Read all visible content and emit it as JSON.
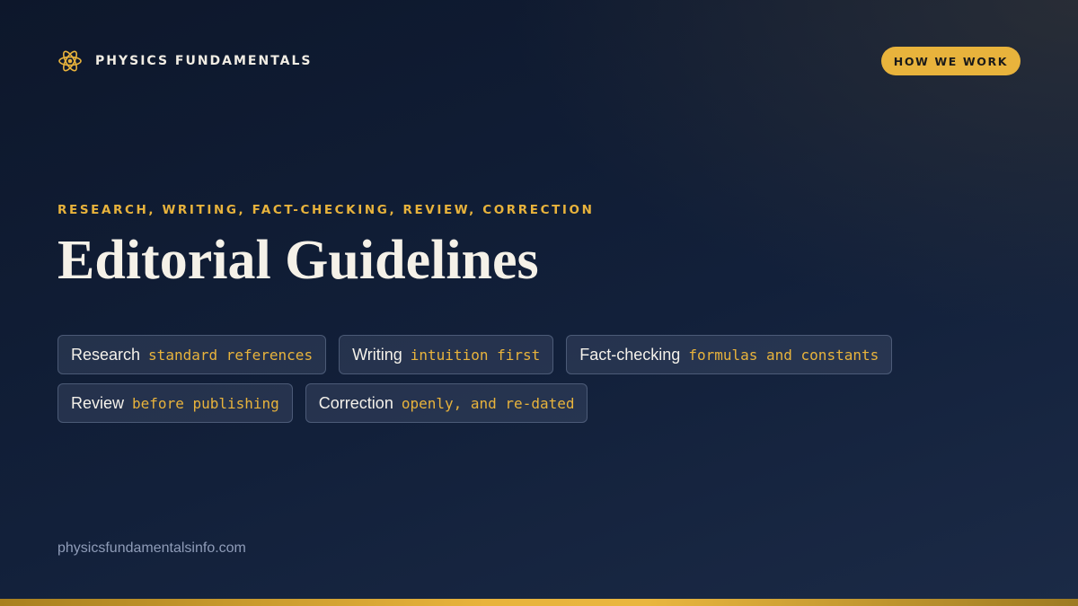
{
  "brand": {
    "name": "PHYSICS FUNDAMENTALS",
    "icon": "atom-icon"
  },
  "header": {
    "cta_label": "HOW WE WORK"
  },
  "hero": {
    "eyebrow": "RESEARCH, WRITING, FACT-CHECKING, REVIEW, CORRECTION",
    "title": "Editorial Guidelines"
  },
  "principles": [
    {
      "label": "Research",
      "value": "standard references"
    },
    {
      "label": "Writing",
      "value": "intuition first"
    },
    {
      "label": "Fact-checking",
      "value": "formulas and constants"
    },
    {
      "label": "Review",
      "value": "before publishing"
    },
    {
      "label": "Correction",
      "value": "openly, and re-dated"
    }
  ],
  "footer": {
    "url": "physicsfundamentalsinfo.com"
  },
  "colors": {
    "accent": "#e8b33c",
    "background": "#0d172b",
    "title": "#f5f1e8",
    "muted": "#8f9cb8"
  }
}
